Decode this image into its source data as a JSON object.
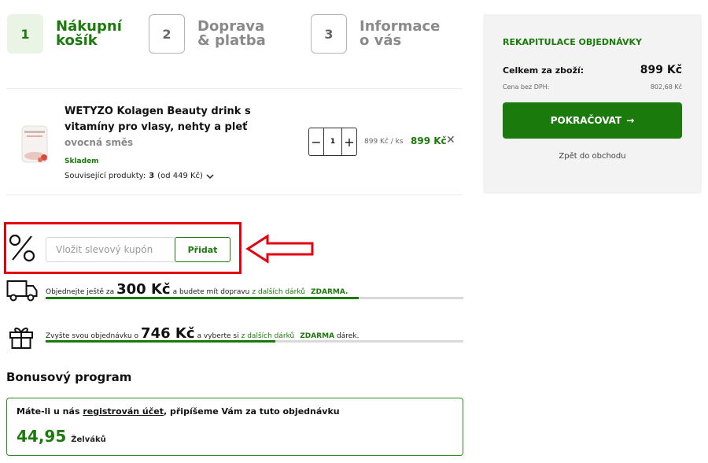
{
  "steps": [
    {
      "number": "1",
      "label_line1": "Nákupní",
      "label_line2": "košík",
      "active": true
    },
    {
      "number": "2",
      "label_line1": "Doprava",
      "label_line2": "& platba",
      "active": false
    },
    {
      "number": "3",
      "label_line1": "Informace",
      "label_line2": "o vás",
      "active": false
    }
  ],
  "cart_item": {
    "name": "WETYZO Kolagen Beauty drink s vitamíny pro vlasy, nehty a pleť",
    "variant": "ovocná směs",
    "stock": "Skladem",
    "related_label": "Související produkty:",
    "related_count": "3",
    "related_from": "(od 449 Kč)",
    "quantity": "1",
    "qty_minus": "−",
    "qty_plus": "+",
    "unit_price": "899 Kč",
    "unit_suffix": "/ ks",
    "line_total": "899 Kč",
    "remove_symbol": "✕"
  },
  "coupon": {
    "placeholder": "Vložit slevový kupón",
    "button_label": "Přidat"
  },
  "shipping_progress": {
    "text_before": "Objednejte ještě za",
    "amount": "300 Kč",
    "text_after": "a budete mít dopravu",
    "link": "z dalších dárků",
    "free": "ZDARMA.",
    "progress": 0.75
  },
  "gift_progress": {
    "text_before": "Zvyšte svou objednávku o",
    "amount": "746 Kč",
    "text_after": "a vyberte si",
    "link": "z dalších dárků",
    "free": "ZDARMA",
    "text_end": "dárek.",
    "progress": 0.55
  },
  "bonus": {
    "title": "Bonusový program",
    "text_before": "Máte-li u nás",
    "link": "registrován účet",
    "text_after": ", připíšeme Vám za tuto objednávku",
    "points": "44,95",
    "unit": "Želváků"
  },
  "summary": {
    "title": "REKAPITULACE OBJEDNÁVKY",
    "total_label": "Celkem za zboží:",
    "total_value": "899 Kč",
    "net_label": "Cena bez DPH:",
    "net_value": "802,68 Kč",
    "continue_label": "POKRAČOVAT",
    "continue_arrow": "→",
    "back_label": "Zpět do obchodu"
  },
  "colors": {
    "accent": "#1b7a0c",
    "highlight": "#e3000f"
  }
}
